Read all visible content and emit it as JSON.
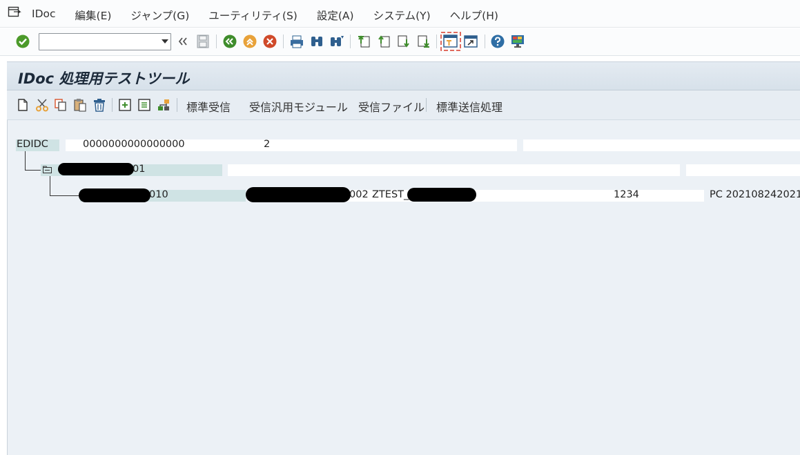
{
  "menubar": {
    "items": [
      "IDoc",
      "編集(E)",
      "ジャンプ(G)",
      "ユーティリティ(S)",
      "設定(A)",
      "システム(Y)",
      "ヘルプ(H)"
    ]
  },
  "toolbar": {
    "command_value": "",
    "icons": [
      "enter-icon",
      "back-icon",
      "save-icon",
      "green-back-icon",
      "exit-icon",
      "cancel-icon",
      "print-icon",
      "find-icon",
      "find-next-icon",
      "first-page-icon",
      "previous-page-icon",
      "next-page-icon",
      "last-page-icon",
      "new-session-icon",
      "shortcut-icon",
      "help-icon",
      "customize-layout-icon"
    ]
  },
  "title": "IDoc 処理用テストツール",
  "app_toolbar": {
    "buttons": [
      "標準受信",
      "受信汎用モジュール",
      "受信ファイル",
      "標準送信処理"
    ]
  },
  "tree": {
    "root": {
      "label": "EDIDC",
      "value1": "0000000000000000",
      "value2": "2"
    },
    "level1": {
      "suffix": "01"
    },
    "level2": {
      "suffix": "010",
      "col2_suffix": "002",
      "col3": "ZTEST_",
      "col4": "1234",
      "col5": "PC 202108242021"
    }
  }
}
